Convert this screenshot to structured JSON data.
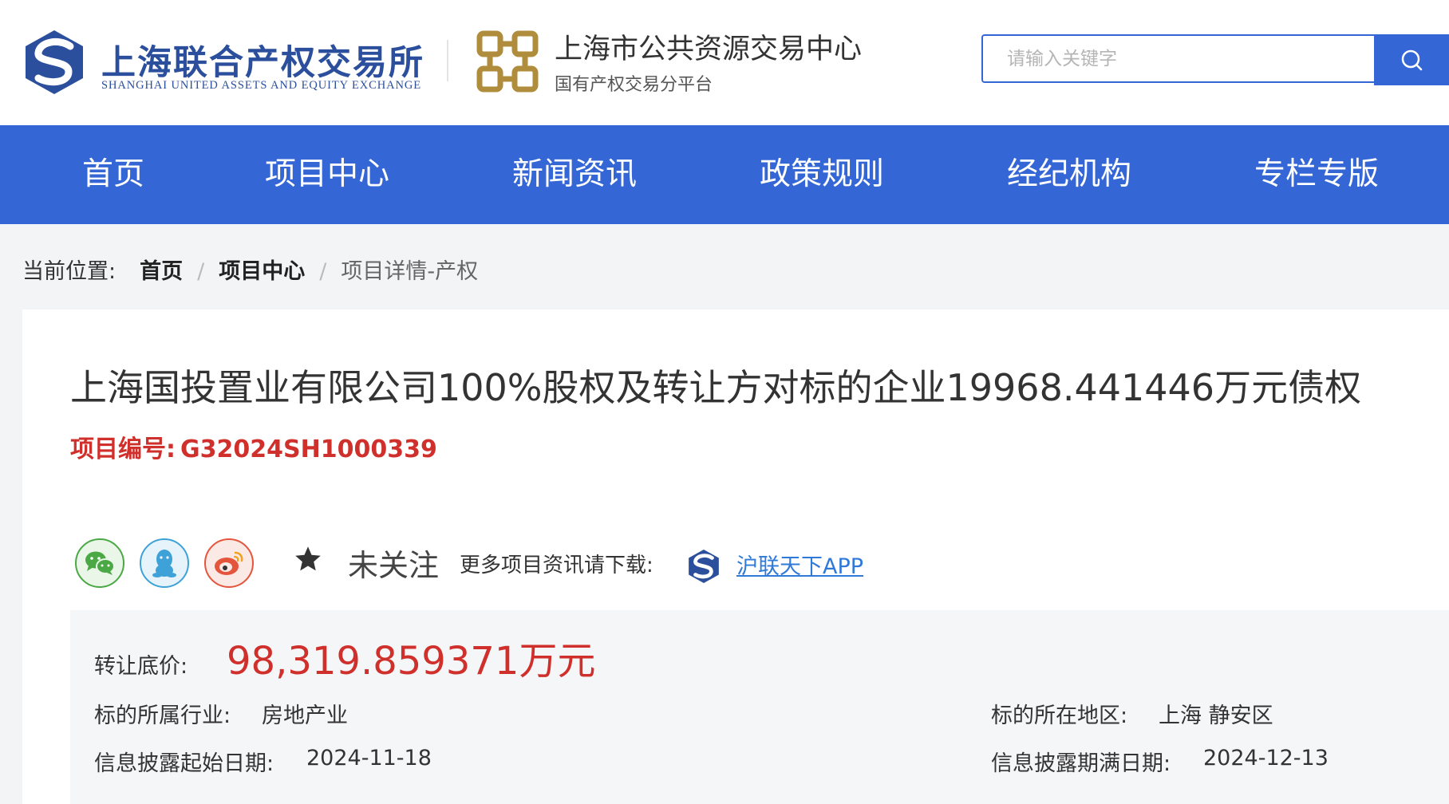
{
  "header": {
    "logo_cn": "上海联合产权交易所",
    "logo_en": "SHANGHAI UNITED ASSETS AND EQUITY EXCHANGE",
    "center_title": "上海市公共资源交易中心",
    "center_subtitle": "国有产权交易分平台",
    "search": {
      "placeholder": "请输入关键字",
      "value": ""
    }
  },
  "nav": {
    "items": [
      {
        "label": "首页"
      },
      {
        "label": "项目中心"
      },
      {
        "label": "新闻资讯"
      },
      {
        "label": "政策规则"
      },
      {
        "label": "经纪机构"
      },
      {
        "label": "专栏专版"
      }
    ]
  },
  "breadcrumb": {
    "label": "当前位置:",
    "items": [
      "首页",
      "项目中心"
    ],
    "separator": "/",
    "current": "项目详情-产权"
  },
  "project": {
    "title": "上海国投置业有限公司100%股权及转让方对标的企业19968.441446万元债权",
    "code_label": "项目编号:",
    "code": "G32024SH1000339",
    "follow_status": "未关注",
    "download_label": "更多项目资讯请下载:",
    "app_link": "沪联天下APP",
    "price_label": "转让底价:",
    "price_value": "98,319.859371万元",
    "industry_label": "标的所属行业:",
    "industry_value": "房地产业",
    "region_label": "标的所在地区:",
    "region_value": "上海 静安区",
    "start_label": "信息披露起始日期:",
    "start_value": "2024-11-18",
    "end_label": "信息披露期满日期:",
    "end_value": "2024-12-13"
  },
  "icons": {
    "share": [
      "wechat-icon",
      "qq-icon",
      "weibo-icon"
    ],
    "follow": "star-icon",
    "search": "search-icon"
  },
  "colors": {
    "primary": "#3466d6",
    "accent_red": "#d0302b",
    "link": "#2f79d8",
    "logo_blue": "#2b4f9c",
    "gold": "#b08d3c"
  }
}
